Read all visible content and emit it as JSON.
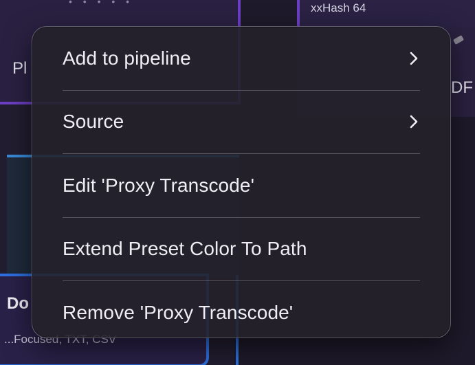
{
  "background": {
    "top_right_node_label": "xxHash 64",
    "left_edge_text": "Pl",
    "right_edge_text": "DF",
    "bottom_left_title": "Do",
    "bottom_left_subtitle": "...Focused, TXT, CSV"
  },
  "context_menu": {
    "items": [
      {
        "label": "Add to pipeline",
        "has_submenu": true,
        "submenu_icon": "chevron-right-icon"
      },
      {
        "label": "Source",
        "has_submenu": true,
        "submenu_icon": "chevron-right-icon"
      },
      {
        "label": "Edit 'Proxy Transcode'",
        "has_submenu": false
      },
      {
        "label": "Extend Preset Color To Path",
        "has_submenu": false
      },
      {
        "label": "Remove 'Proxy Transcode'",
        "has_submenu": false
      }
    ]
  },
  "colors": {
    "menu_background": "#24212a",
    "menu_text": "#f0eef4",
    "node_accent_purple": "#6b3fc4",
    "node_accent_blue": "#2d6fe0"
  }
}
